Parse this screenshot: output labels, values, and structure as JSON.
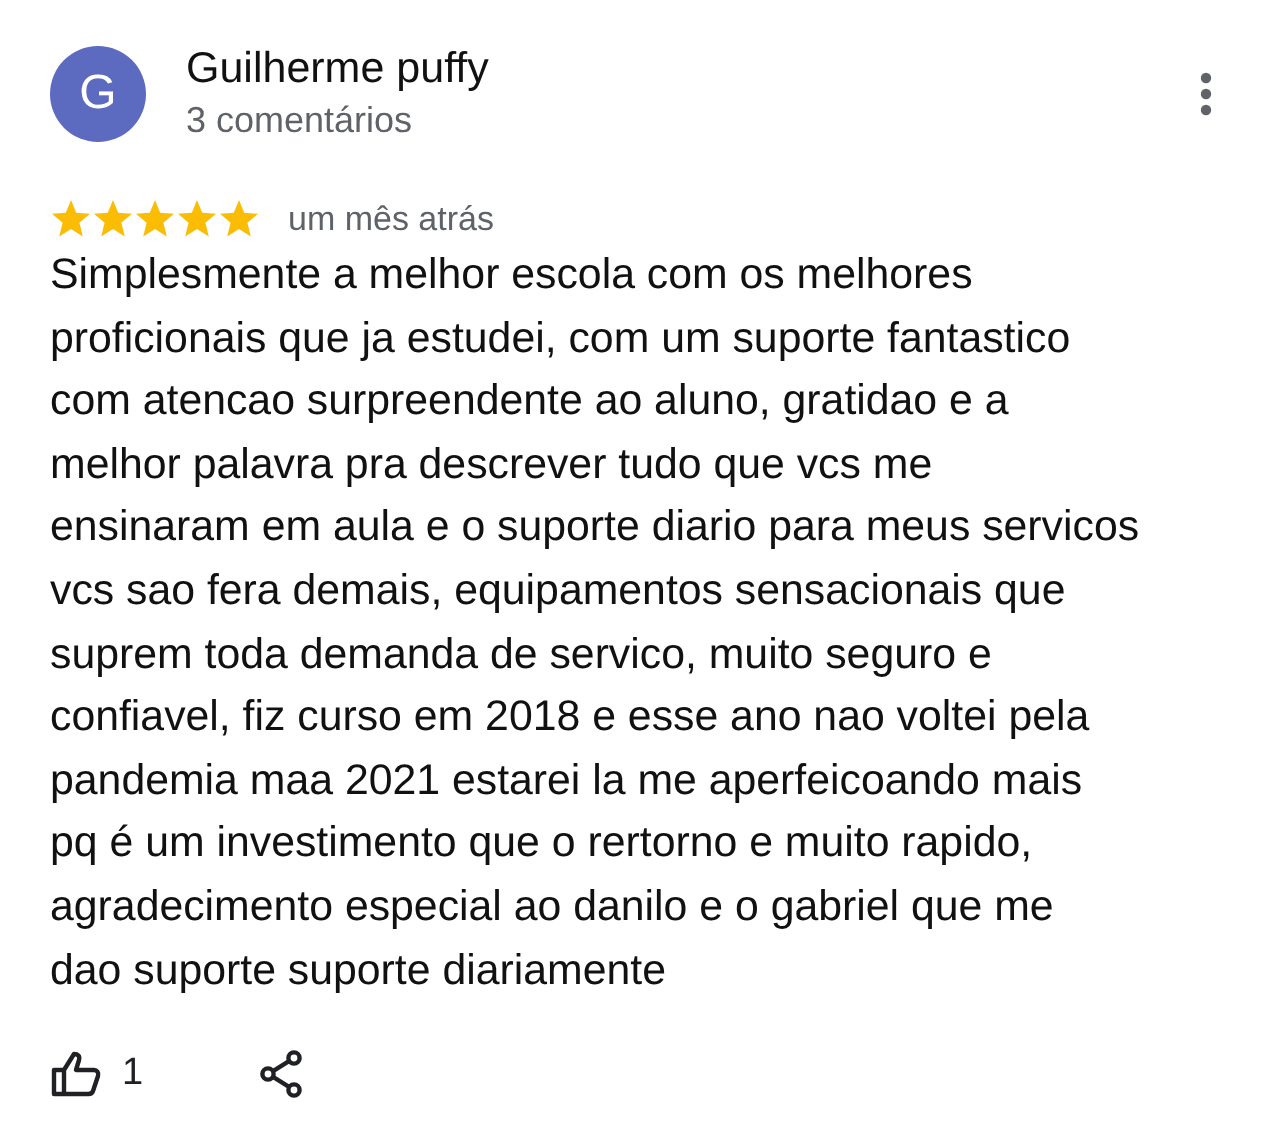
{
  "review": {
    "avatar_letter": "G",
    "author": "Guilherme puffy",
    "subtitle": "3 comentários",
    "stars": 5,
    "time": "um mês atrás",
    "text_lines": [
      "Simplesmente a melhor escola com os melhores",
      "proficionais que ja estudei, com um suporte fantastico",
      "com atencao surpreendente ao aluno, gratidao e a",
      "melhor palavra pra descrever tudo que vcs me",
      "ensinaram em aula e o suporte diario para meus servicos",
      "vcs sao fera demais, equipamentos sensacionais que",
      "suprem toda demanda de servico, muito seguro e",
      "confiavel, fiz curso em 2018 e esse ano nao voltei pela",
      "pandemia maa 2021 estarei la me aperfeicoando mais",
      "pq é um investimento que o rertorno e muito rapido,",
      "agradecimento especial ao danilo e o gabriel que me",
      "dao suporte suporte diariamente"
    ],
    "likes": "1"
  }
}
